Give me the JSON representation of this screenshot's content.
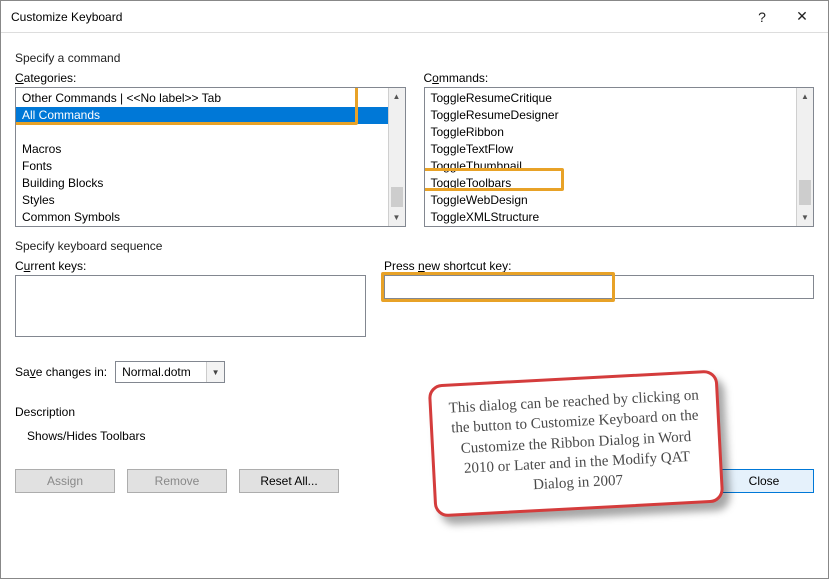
{
  "titlebar": {
    "title": "Customize Keyboard",
    "help": "?",
    "close": "✕"
  },
  "labels": {
    "specify_command": "Specify a command",
    "categories": "Categories:",
    "commands": "Commands:",
    "specify_sequence": "Specify keyboard sequence",
    "current_keys": "Current keys:",
    "press_new": "Press new shortcut key:",
    "save_changes": "Save changes in:",
    "description": "Description"
  },
  "categories": {
    "items": [
      "Other Commands | <<No label>> Tab",
      "All Commands",
      "",
      "Macros",
      "Fonts",
      "Building Blocks",
      "Styles",
      "Common Symbols"
    ],
    "selected_index": 1
  },
  "commands": {
    "items": [
      "ToggleResumeCritique",
      "ToggleResumeDesigner",
      "ToggleRibbon",
      "ToggleTextFlow",
      "ToggleThumbnail",
      "ToggleToolbars",
      "ToggleWebDesign",
      "ToggleXMLStructure"
    ],
    "highlighted_index": 5
  },
  "save_in": {
    "value": "Normal.dotm"
  },
  "description_text": "Shows/Hides Toolbars",
  "buttons": {
    "assign": "Assign",
    "remove": "Remove",
    "reset": "Reset All...",
    "close": "Close"
  },
  "callout_text": "This dialog can be reached by clicking on the button to Customize Keyboard on the Customize the Ribbon Dialog in Word 2010 or Later and in the Modify QAT Dialog in 2007"
}
